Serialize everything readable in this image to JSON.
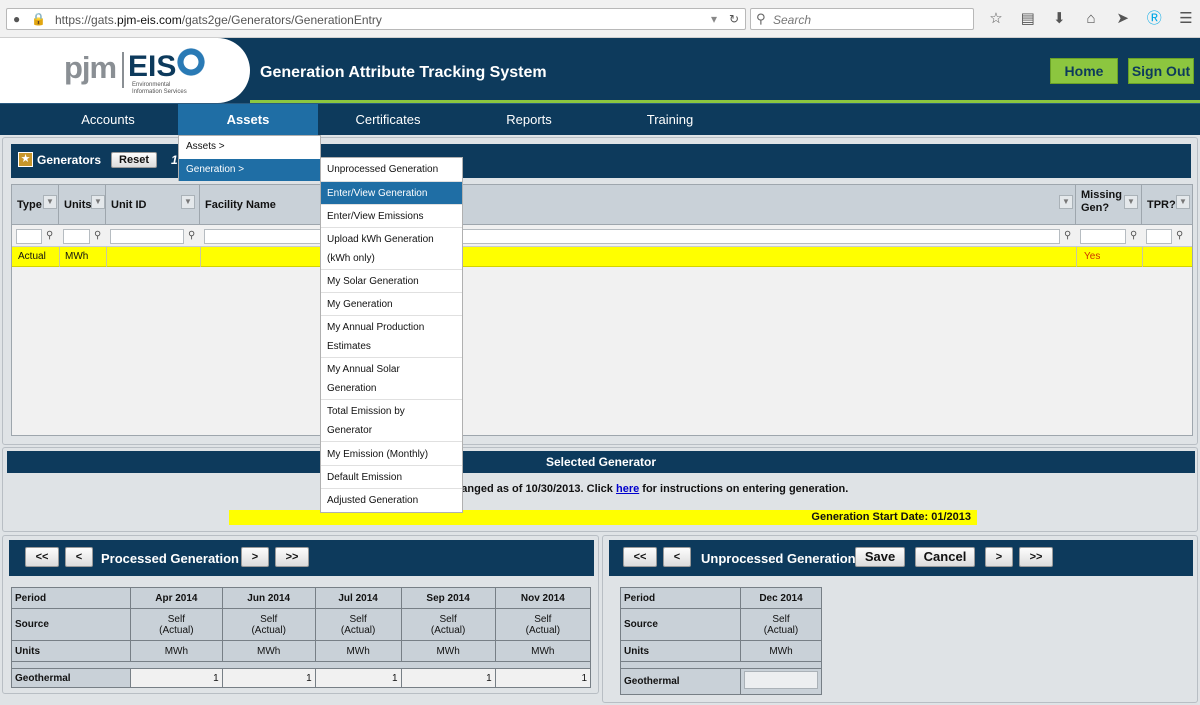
{
  "browser": {
    "url_prefix": "https://gats.",
    "url_domain": "pjm-eis.com",
    "url_path": "/gats2ge/Generators/GenerationEntry",
    "search_placeholder": "Search",
    "url_icons": [
      "globe-icon",
      "lock-icon"
    ],
    "toolbar_icons": [
      "star-icon",
      "reading-list-icon",
      "download-icon",
      "home-icon",
      "send-icon",
      "skype-icon",
      "menu-icon"
    ]
  },
  "header": {
    "logo_pjm": "pjm",
    "logo_eis": "EIS",
    "logo_sub_1": "Environmental",
    "logo_sub_2": "Information Services",
    "title": "Generation Attribute Tracking System",
    "home_btn": "Home",
    "signout_btn": "Sign Out"
  },
  "nav": {
    "items": [
      "Accounts",
      "Assets",
      "Certificates",
      "Reports",
      "Training"
    ],
    "active": "Assets"
  },
  "assets_menu": [
    "Assets >",
    "Generation >"
  ],
  "generation_menu": [
    "Unprocessed Generation",
    "Enter/View Generation",
    "Enter/View Emissions",
    "Upload kWh Generation (kWh only)",
    "My Solar Generation",
    "My Generation",
    "My Annual Production Estimates",
    "My Annual Solar Generation",
    "Total Emission by Generator",
    "My Emission (Monthly)",
    "Default Emission",
    "Adjusted Generation"
  ],
  "generators": {
    "title": "Generators",
    "reset_btn": "Reset",
    "count": "1",
    "columns": [
      "Type",
      "Units",
      "Unit ID",
      "Facility Name",
      "Missing Gen?",
      "TPR?"
    ],
    "row": {
      "type": "Actual",
      "units": "MWh",
      "unit_id": "",
      "facility": "",
      "missing": "Yes",
      "tpr": ""
    }
  },
  "selected": {
    "title": "Selected Generator",
    "text_before": "ranged as of 10/30/2013. Click ",
    "link": "here",
    "text_after": " for instructions on entering generation.",
    "start_date": "Generation Start Date: 01/2013"
  },
  "processed": {
    "title": "Processed Generation",
    "nav": [
      "<<",
      "<",
      ">",
      ">>"
    ],
    "row_labels": [
      "Period",
      "Source",
      "Units",
      "Geothermal"
    ],
    "periods": [
      {
        "period": "Apr 2014",
        "source_1": "Self",
        "source_2": "(Actual)",
        "units": "MWh",
        "value": "1"
      },
      {
        "period": "Jun 2014",
        "source_1": "Self",
        "source_2": "(Actual)",
        "units": "MWh",
        "value": "1"
      },
      {
        "period": "Jul 2014",
        "source_1": "Self",
        "source_2": "(Actual)",
        "units": "MWh",
        "value": "1"
      },
      {
        "period": "Sep 2014",
        "source_1": "Self",
        "source_2": "(Actual)",
        "units": "MWh",
        "value": "1"
      },
      {
        "period": "Nov 2014",
        "source_1": "Self",
        "source_2": "(Actual)",
        "units": "MWh",
        "value": "1"
      }
    ]
  },
  "unprocessed": {
    "title": "Unprocessed Generation",
    "nav": [
      "<<",
      "<",
      ">",
      ">>"
    ],
    "save_btn": "Save",
    "cancel_btn": "Cancel",
    "row_labels": [
      "Period",
      "Source",
      "Units",
      "Geothermal"
    ],
    "period": "Dec 2014",
    "source_1": "Self",
    "source_2": "(Actual)",
    "units": "MWh",
    "value": ""
  },
  "colors": {
    "navy": "#0d3a5c",
    "accent_blue": "#1f6ea5",
    "green": "#8cc63f",
    "highlight_yellow": "#ffff00"
  }
}
